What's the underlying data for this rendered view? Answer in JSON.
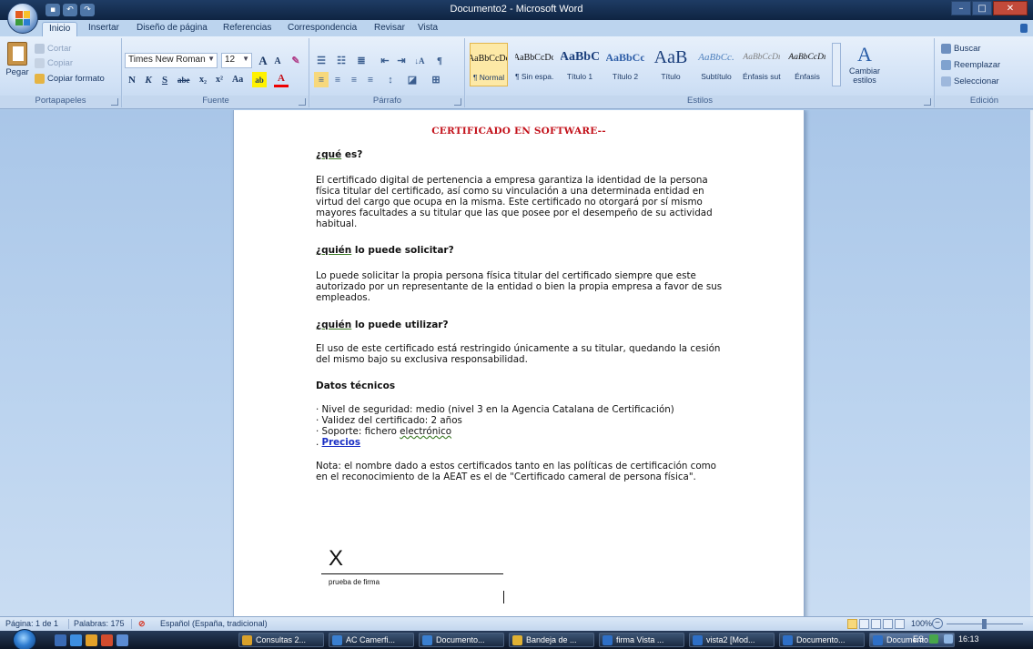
{
  "window": {
    "title": "Documento2 - Microsoft Word",
    "controls": {
      "minimize": "–",
      "maximize": "□",
      "close": "✕"
    }
  },
  "tabs": [
    "Inicio",
    "Insertar",
    "Diseño de página",
    "Referencias",
    "Correspondencia",
    "Revisar",
    "Vista"
  ],
  "ribbon": {
    "clipboard": {
      "paste": "Pegar",
      "cut": "Cortar",
      "copy": "Copiar",
      "format_painter": "Copiar formato",
      "label": "Portapapeles"
    },
    "font": {
      "family": "Times New Roman",
      "size": "12",
      "grow": "A",
      "shrink": "A",
      "clear": "✎",
      "bold": "N",
      "italic": "K",
      "underline": "S",
      "strike": "abe",
      "subscript": "x₂",
      "superscript": "x²",
      "case": "Aa",
      "highlight": "ab",
      "color": "A",
      "label": "Fuente"
    },
    "paragraph": {
      "label": "Párrafo",
      "sort": "↓A",
      "pilcrow": "¶"
    },
    "styles": {
      "items": [
        {
          "sample": "AaBbCcDc",
          "name": "¶ Normal",
          "selected": true
        },
        {
          "sample": "AaBbCcDc",
          "name": "¶ Sin espa...",
          "selected": false
        },
        {
          "sample": "AaBbC",
          "name": "Título 1",
          "selected": false
        },
        {
          "sample": "AaBbCc",
          "name": "Título 2",
          "selected": false
        },
        {
          "sample": "AaB",
          "name": "Título",
          "selected": false
        },
        {
          "sample": "AaBbCc.",
          "name": "Subtítulo",
          "selected": false
        },
        {
          "sample": "AaBbCcDı",
          "name": "Énfasis sutil",
          "selected": false
        },
        {
          "sample": "AaBbCcDı",
          "name": "Énfasis",
          "selected": false
        }
      ],
      "change_styles": "Cambiar estilos",
      "label": "Estilos"
    },
    "editing": {
      "find": "Buscar",
      "replace": "Reemplazar",
      "select": "Seleccionar",
      "label": "Edición"
    }
  },
  "document": {
    "title": "CERTIFICADO  EN SOFTWARE--",
    "s1_head_u": "¿qué",
    "s1_head_rest": " es?",
    "s1_body": "El certificado digital de pertenencia a empresa garantiza la identidad de la persona física titular del certificado, así como su vinculación a una determinada entidad en virtud del cargo que ocupa en la misma. Este certificado no otorgará por sí mismo mayores facultades a su titular que las que posee por el desempeño de su actividad habitual.",
    "s2_head_u": "¿quién",
    "s2_head_rest": " lo puede solicitar?",
    "s2_body": "Lo puede solicitar la propia persona física titular del certificado siempre que este autorizado por un representante de la entidad o bien la propia empresa a favor de sus empleados.",
    "s3_head_u": "¿quién",
    "s3_head_rest": " lo puede utilizar?",
    "s3_body": "El uso de este certificado está restringido únicamente a su titular, quedando la cesión del mismo bajo su exclusiva responsabilidad.",
    "s4_head": "Datos técnicos",
    "tech_1": "· Nivel de seguridad: medio (nivel 3 en la Agencia Catalana de Certificación)",
    "tech_2": "· Validez del certificado: 2 años",
    "tech_3a": "· Soporte: fichero ",
    "tech_3b": "electrónico",
    "tech_4_dot": ". ",
    "tech_4_link": "Precios",
    "note": "Nota: el nombre dado a estos certificados tanto en las políticas de certificación como en el reconocimiento de la AEAT es el de \"Certificado cameral de persona física\".",
    "signature_x": "X",
    "signature_label": "prueba de firma"
  },
  "status": {
    "page": "Página: 1 de 1",
    "words": "Palabras: 175",
    "language": "Español (España, tradicional)",
    "zoom": "100%"
  },
  "taskbar": {
    "items": [
      {
        "label": "Consultas 2...",
        "color": "#d9a12b",
        "active": false
      },
      {
        "label": "AC Camerfi...",
        "color": "#3a7fd0",
        "active": false
      },
      {
        "label": "Documento...",
        "color": "#3a7fd0",
        "active": false
      },
      {
        "label": "Bandeja de ...",
        "color": "#e0b133",
        "active": false
      },
      {
        "label": "firma Vista ...",
        "color": "#2e6fc6",
        "active": false
      },
      {
        "label": "vista2 [Mod...",
        "color": "#2e6fc6",
        "active": false
      },
      {
        "label": "Documento...",
        "color": "#2e6fc6",
        "active": false
      },
      {
        "label": "Documento...",
        "color": "#2e6fc6",
        "active": true
      }
    ],
    "tray_lang": "ES",
    "clock": "16:13"
  }
}
